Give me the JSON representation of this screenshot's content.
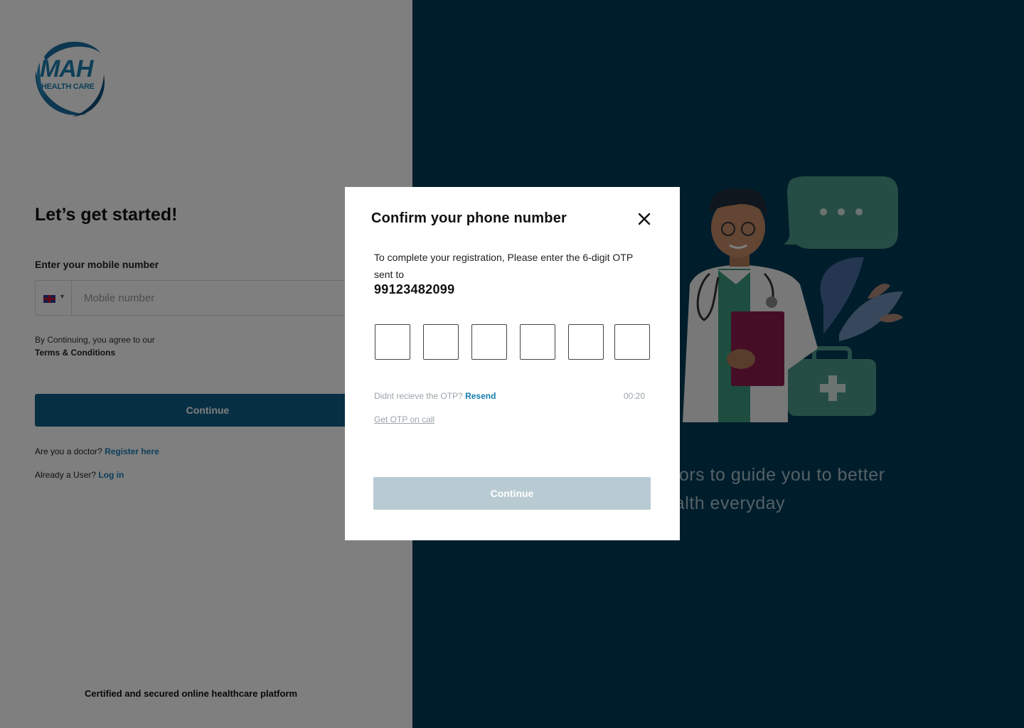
{
  "brand": {
    "logo_primary": "MAH",
    "logo_secondary": "HEALTH CARE"
  },
  "signup": {
    "heading": "Let’s get started!",
    "mobile_label": "Enter your mobile number",
    "phone_placeholder": "Mobile number",
    "country_flag": "uk-flag-icon",
    "terms_text": "By Continuing, you agree to our",
    "terms_link": "Terms & Conditions",
    "continue_label": "Continue",
    "doctor_prompt": "Are you a doctor?",
    "doctor_link": "Register here",
    "user_prompt": "Already a User?",
    "user_link": "Log in",
    "footer": "Certified and secured online healthcare platform"
  },
  "promo": {
    "tagline_line1": "octors to guide you to better",
    "tagline_line2": "health everyday"
  },
  "modal": {
    "title": "Confirm your phone number",
    "description": "To complete your registration, Please enter the 6-digit OTP sent to",
    "phone_number": "99123482099",
    "otp_values": [
      "",
      "",
      "",
      "",
      "",
      ""
    ],
    "resend_prompt": "Didnt recieve the OTP?",
    "resend_link": "Resend",
    "timer": "00:20",
    "otp_call_link": "Get OTP on call",
    "continue_label": "Continue"
  },
  "colors": {
    "primary": "#0e5f86",
    "right_panel": "#003a56",
    "link": "#1a7fb4",
    "disabled_button": "#b9cbd2"
  }
}
